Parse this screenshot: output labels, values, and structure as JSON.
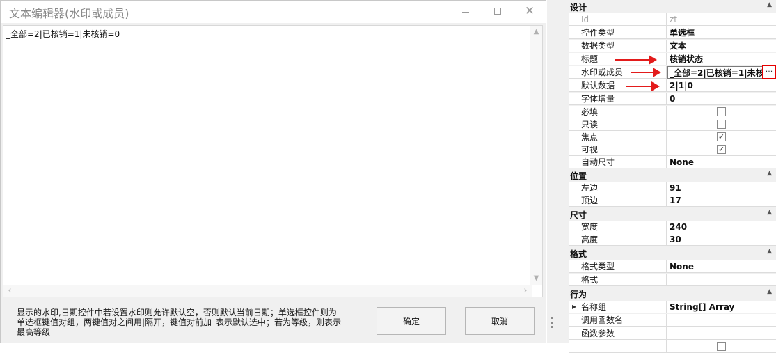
{
  "dialog": {
    "title": "文本编辑器(水印或成员)",
    "editor_text": "_全部=2|已核销=1|未核销=0",
    "hint_lines": [
      "显示的水印,日期控件中若设置水印则允许默认空，否则默认当前日期；单选框控件则为",
      "单选框键值对组，两键值对之间用|隔开，键值对前加_表示默认选中；若为等级，则表示",
      "最高等级"
    ],
    "ok_label": "确定",
    "cancel_label": "取消"
  },
  "property_grid": {
    "categories": {
      "design": "设计",
      "position": "位置",
      "size": "尺寸",
      "format": "格式",
      "behavior": "行为"
    },
    "design_rows": [
      {
        "name": "Id",
        "value": "zt"
      },
      {
        "name": "控件类型",
        "value": "单选框"
      },
      {
        "name": "数据类型",
        "value": "文本"
      },
      {
        "name": "标题",
        "value": "核销状态"
      },
      {
        "name": "水印或成员",
        "value": "_全部=2|已核销=1|未核销=0"
      },
      {
        "name": "默认数据",
        "value": "2|1|0"
      },
      {
        "name": "字体增量",
        "value": "0"
      },
      {
        "name": "必填",
        "value": "unchecked"
      },
      {
        "name": "只读",
        "value": "unchecked"
      },
      {
        "name": "焦点",
        "value": "checked"
      },
      {
        "name": "可视",
        "value": "checked"
      },
      {
        "name": "自动尺寸",
        "value": "None"
      }
    ],
    "position_rows": [
      {
        "name": "左边",
        "value": "91"
      },
      {
        "name": "顶边",
        "value": "17"
      }
    ],
    "size_rows": [
      {
        "name": "宽度",
        "value": "240"
      },
      {
        "name": "高度",
        "value": "30"
      }
    ],
    "format_rows": [
      {
        "name": "格式类型",
        "value": "None"
      },
      {
        "name": "格式",
        "value": ""
      }
    ],
    "behavior_rows": [
      {
        "name": "名称组",
        "value": "String[] Array"
      },
      {
        "name": "调用函数名",
        "value": ""
      },
      {
        "name": "函数参数",
        "value": ""
      }
    ]
  },
  "colors": {
    "annotation_red": "#e31b1b"
  }
}
